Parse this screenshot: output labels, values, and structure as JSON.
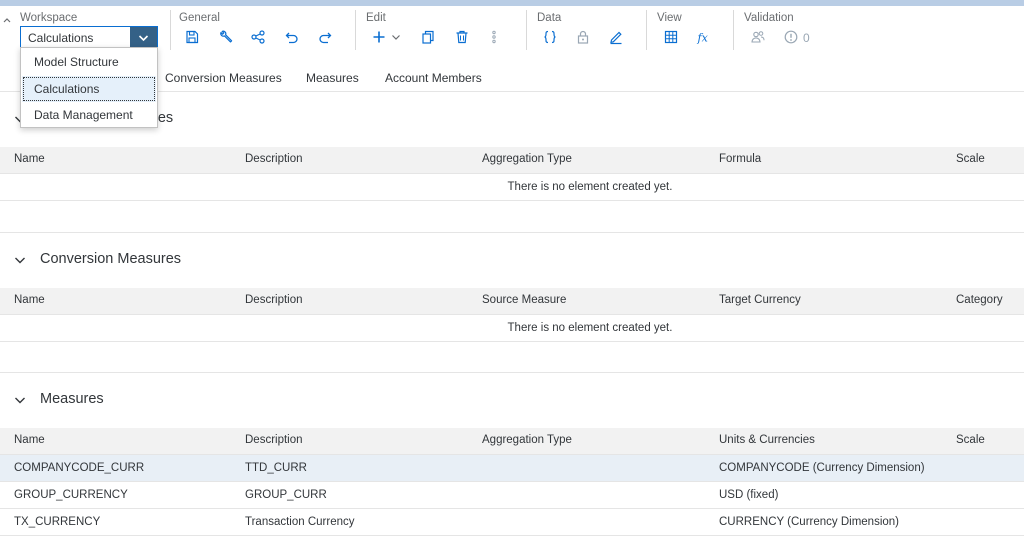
{
  "toolbar": {
    "workspace": {
      "title": "Workspace",
      "selected": "Calculations",
      "options": [
        "Model Structure",
        "Calculations",
        "Data Management"
      ]
    },
    "groups": {
      "general": "General",
      "edit": "Edit",
      "data": "Data",
      "view": "View",
      "validation": "Validation"
    },
    "icons": {
      "general": [
        "save-icon",
        "wrench-icon",
        "share-icon",
        "undo-icon",
        "redo-icon"
      ],
      "edit": [
        "add-icon",
        "copy-icon",
        "delete-icon",
        "more-icon"
      ],
      "data": [
        "braces-icon",
        "lock-icon",
        "edit-pencil-icon"
      ],
      "view": [
        "grid-icon",
        "formula-icon"
      ],
      "validation": [
        "users-icon",
        "warning-circle-icon"
      ]
    },
    "validation_count": "0"
  },
  "tabs": [
    "Conversion Measures",
    "Measures",
    "Account Members"
  ],
  "sections": {
    "calculated": {
      "title_visible": "res",
      "columns": [
        "Name",
        "Description",
        "Aggregation Type",
        "Formula",
        "Scale"
      ],
      "empty_text": "There is no element created yet."
    },
    "conversion": {
      "title": "Conversion Measures",
      "columns": [
        "Name",
        "Description",
        "Source Measure",
        "Target Currency",
        "Category"
      ],
      "empty_text": "There is no element created yet."
    },
    "measures": {
      "title": "Measures",
      "columns": [
        "Name",
        "Description",
        "Aggregation Type",
        "Units & Currencies",
        "Scale"
      ],
      "rows": [
        {
          "name": "COMPANYCODE_CURR",
          "description": "TTD_CURR",
          "aggregation": "",
          "units": "COMPANYCODE (Currency Dimension)",
          "scale": ""
        },
        {
          "name": "GROUP_CURRENCY",
          "description": "GROUP_CURR",
          "aggregation": "",
          "units": "USD (fixed)",
          "scale": ""
        },
        {
          "name": "TX_CURRENCY",
          "description": "Transaction Currency",
          "aggregation": "",
          "units": "CURRENCY (Currency Dimension)",
          "scale": ""
        }
      ]
    }
  },
  "colors": {
    "accent": "#0a6ed1",
    "select_button": "#346187",
    "header_bg": "#f2f2f2",
    "highlight_row": "#e8eff6",
    "top_strip": "#b9cde5"
  }
}
